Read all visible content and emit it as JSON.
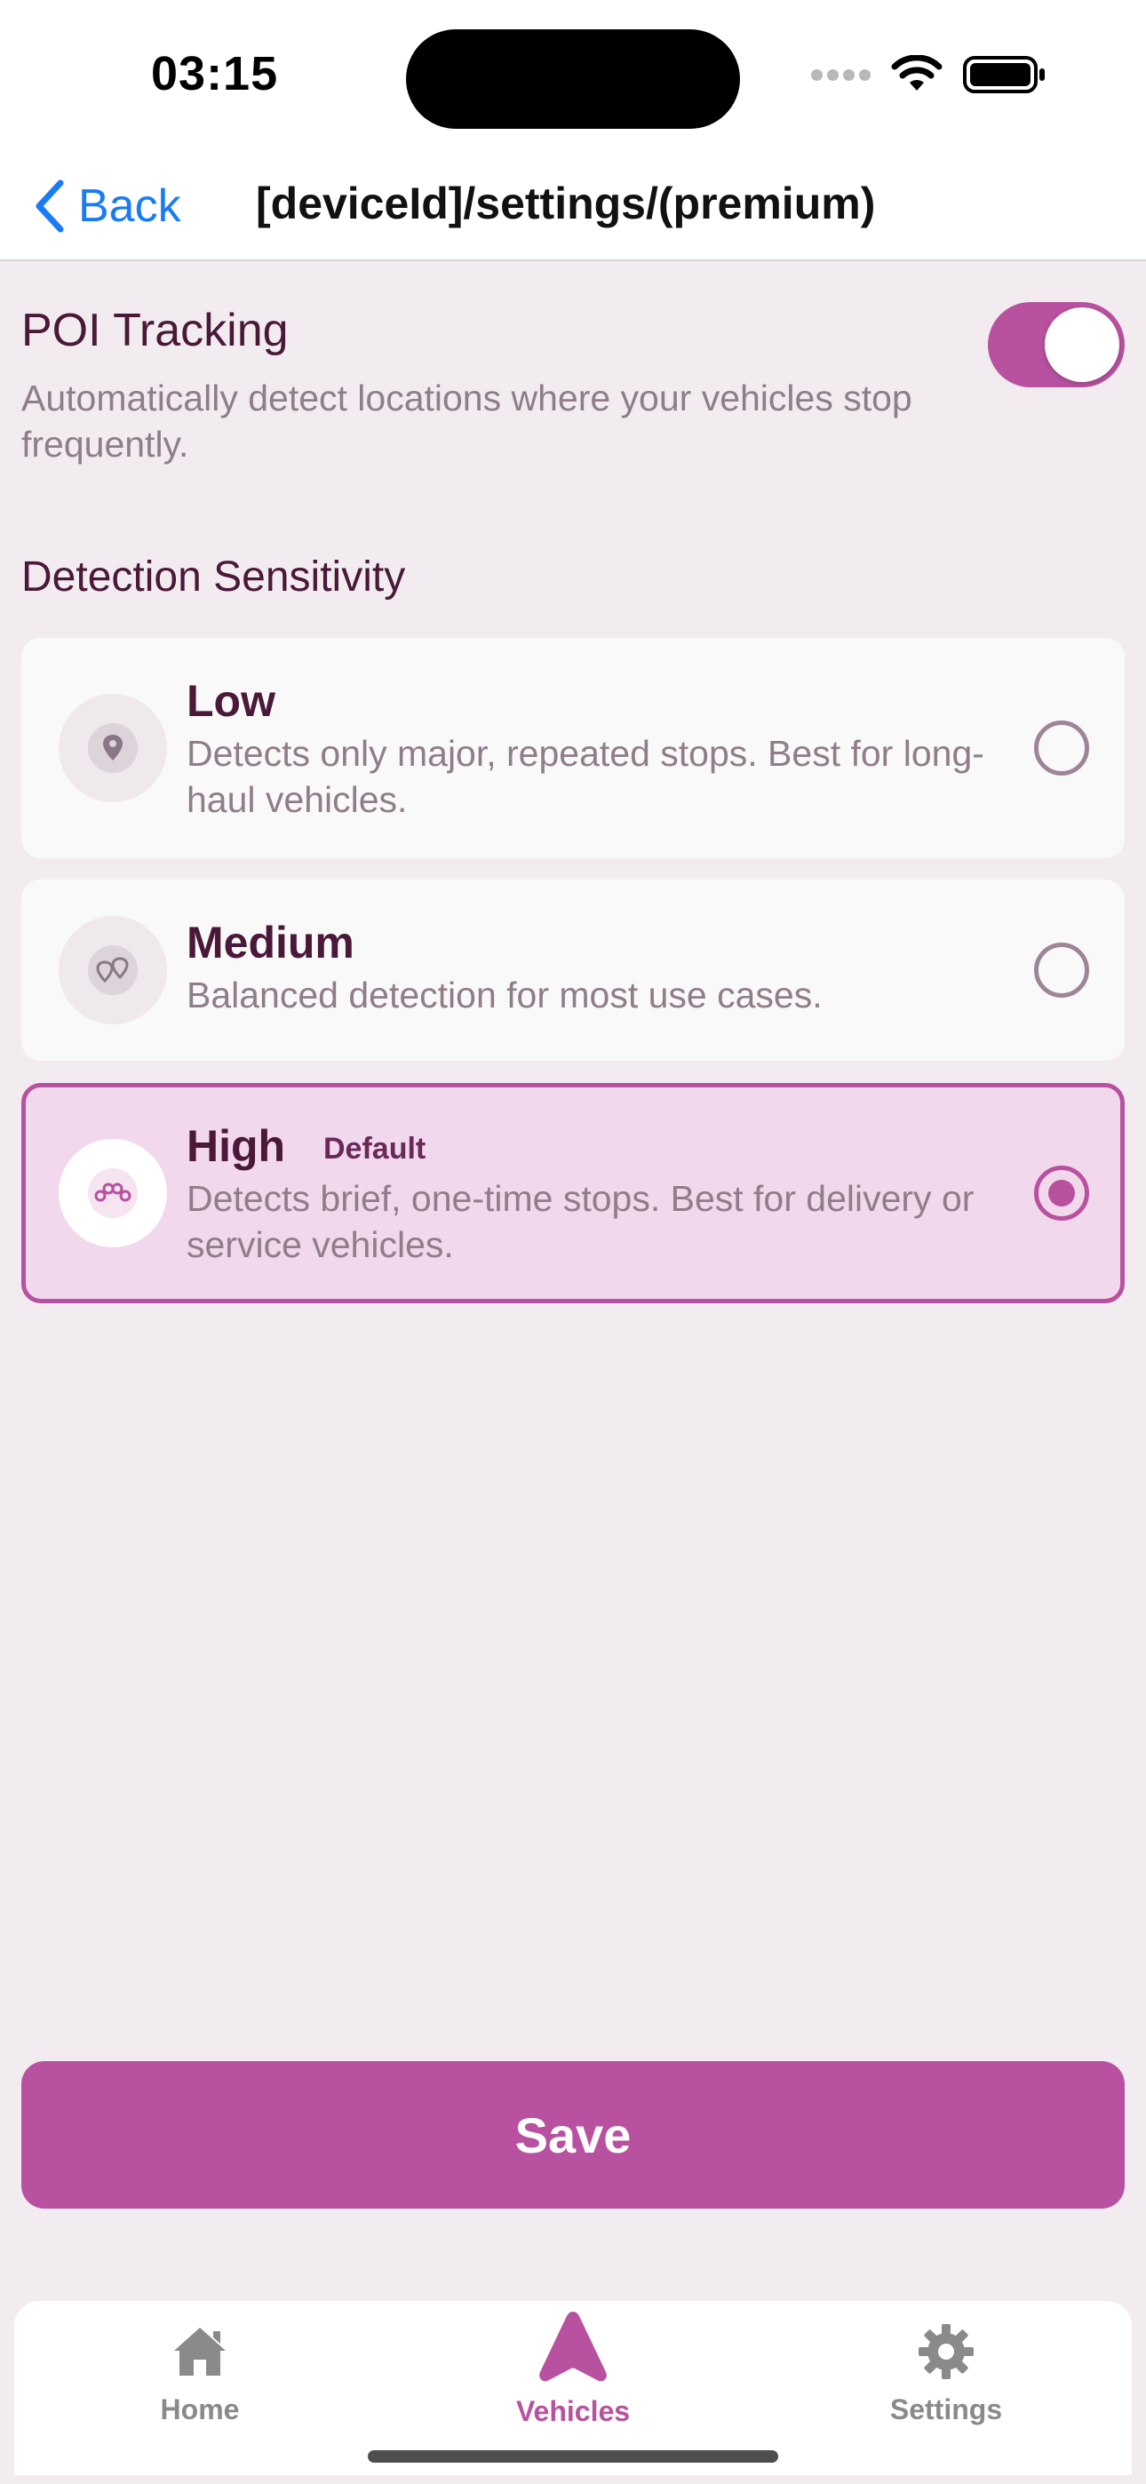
{
  "status_bar": {
    "time": "03:15"
  },
  "nav": {
    "back_label": "Back",
    "title": "[deviceId]/settings/(premium)"
  },
  "poi": {
    "title": "POI Tracking",
    "description": "Automatically detect locations where your vehicles stop frequently.",
    "enabled": true
  },
  "sensitivity": {
    "title": "Detection Sensitivity",
    "options": [
      {
        "title": "Low",
        "badge": "",
        "description": "Detects only major, repeated stops. Best for long-haul vehicles.",
        "icon": "single-pin-icon",
        "selected": false
      },
      {
        "title": "Medium",
        "badge": "",
        "description": "Balanced detection for most use cases.",
        "icon": "double-pin-icon",
        "selected": false
      },
      {
        "title": "High",
        "badge": "Default",
        "description": "Detects brief, one-time stops. Best for delivery or service vehicles.",
        "icon": "multi-pin-icon",
        "selected": true
      }
    ]
  },
  "save_label": "Save",
  "tabs": [
    {
      "label": "Home",
      "icon": "house-icon",
      "active": false
    },
    {
      "label": "Vehicles",
      "icon": "navigation-arrow-icon",
      "active": true
    },
    {
      "label": "Settings",
      "icon": "gear-icon",
      "active": false
    }
  ],
  "colors": {
    "accent": "#b8519f",
    "background": "#f2ecf1",
    "selected_card": "#f1d8ec",
    "link": "#1a7cf5"
  }
}
